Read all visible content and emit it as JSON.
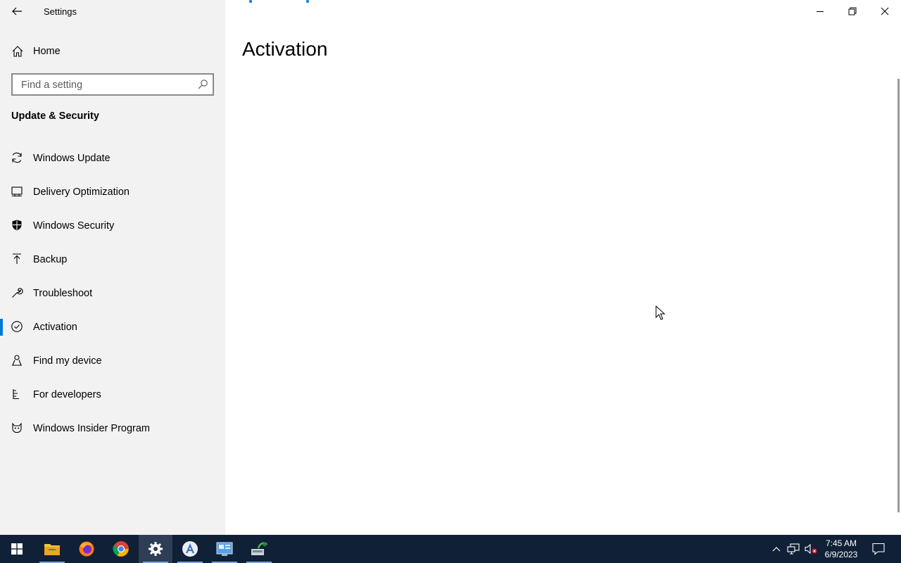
{
  "window": {
    "app_title": "Settings",
    "page_title": "Activation"
  },
  "sidebar": {
    "home_label": "Home",
    "search_placeholder": "Find a setting",
    "section_title": "Update & Security",
    "items": [
      {
        "label": "Windows Update",
        "icon": "sync-icon"
      },
      {
        "label": "Delivery Optimization",
        "icon": "delivery-optimization-icon"
      },
      {
        "label": "Windows Security",
        "icon": "shield-icon"
      },
      {
        "label": "Backup",
        "icon": "backup-arrow-icon"
      },
      {
        "label": "Troubleshoot",
        "icon": "wrench-icon"
      },
      {
        "label": "Activation",
        "icon": "check-circle-icon",
        "active": true
      },
      {
        "label": "Find my device",
        "icon": "person-location-icon"
      },
      {
        "label": "For developers",
        "icon": "developer-tools-icon"
      },
      {
        "label": "Windows Insider Program",
        "icon": "insider-cat-icon"
      }
    ]
  },
  "taskbar": {
    "apps": [
      "windows-start-icon",
      "file-explorer-icon",
      "firefox-icon",
      "chrome-icon",
      "settings-icon",
      "app-installer-icon",
      "control-panel-icon",
      "network-tool-icon"
    ],
    "tray_icons": [
      "chevron-up-icon",
      "network-icon",
      "volume-muted-icon"
    ],
    "time": "7:45 AM",
    "date": "6/9/2023"
  },
  "colors": {
    "accent": "#0078d7",
    "sidebar_bg": "#f2f2f2",
    "taskbar_bg": "#102036"
  }
}
